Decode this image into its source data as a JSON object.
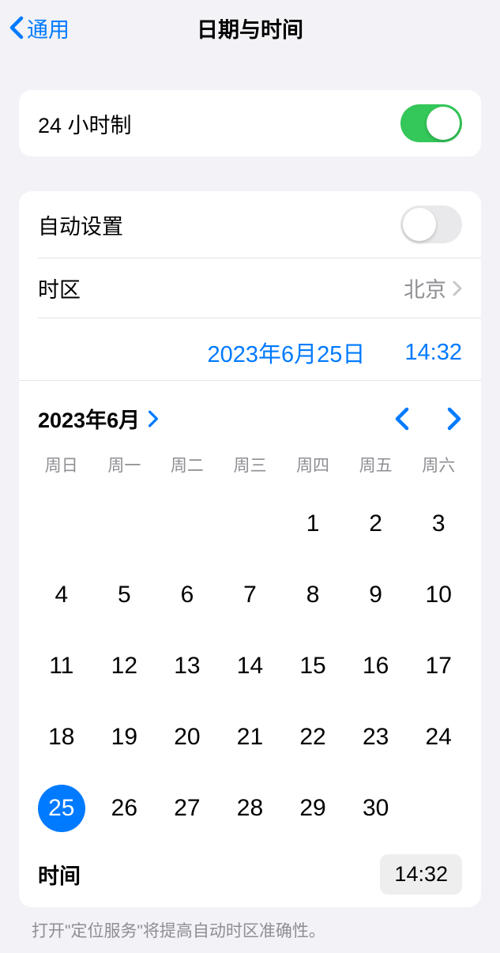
{
  "nav": {
    "back_label": "通用",
    "title": "日期与时间"
  },
  "settings": {
    "hour24_label": "24 小时制",
    "hour24_on": true,
    "auto_set_label": "自动设置",
    "auto_set_on": false,
    "timezone_label": "时区",
    "timezone_value": "北京"
  },
  "datetime": {
    "date_display": "2023年6月25日",
    "time_display": "14:32"
  },
  "calendar": {
    "month_label": "2023年6月",
    "weekdays": [
      "周日",
      "周一",
      "周二",
      "周三",
      "周四",
      "周五",
      "周六"
    ],
    "leading_blanks": 4,
    "days": [
      1,
      2,
      3,
      4,
      5,
      6,
      7,
      8,
      9,
      10,
      11,
      12,
      13,
      14,
      15,
      16,
      17,
      18,
      19,
      20,
      21,
      22,
      23,
      24,
      25,
      26,
      27,
      28,
      29,
      30
    ],
    "selected_day": 25,
    "time_label": "时间",
    "time_value": "14:32"
  },
  "footer": {
    "note": "打开\"定位服务\"将提高自动时区准确性。"
  }
}
